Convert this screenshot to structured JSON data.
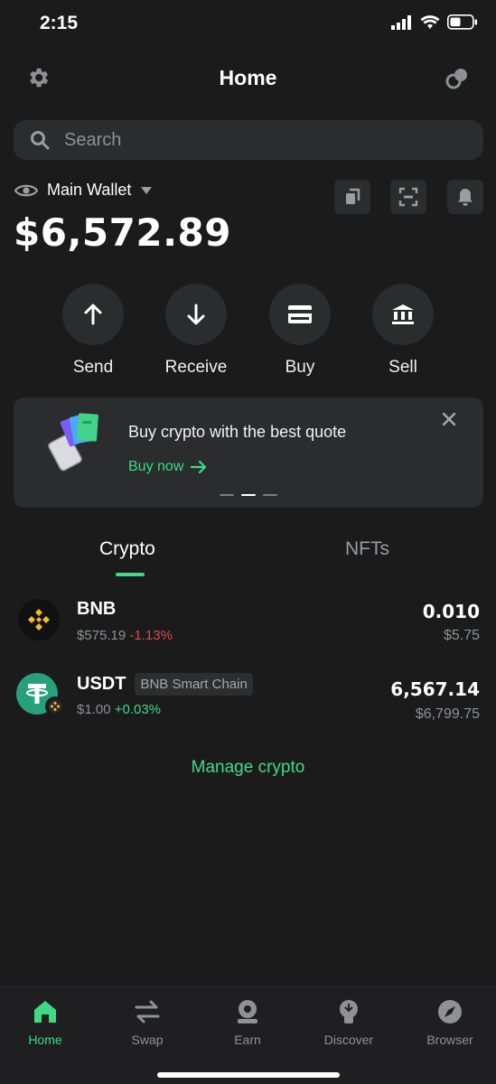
{
  "status": {
    "time": "2:15"
  },
  "header": {
    "title": "Home"
  },
  "search": {
    "placeholder": "Search"
  },
  "wallet": {
    "name": "Main Wallet",
    "balance": "$6,572.89"
  },
  "actions": [
    {
      "label": "Send",
      "icon": "arrow-up-icon"
    },
    {
      "label": "Receive",
      "icon": "arrow-down-icon"
    },
    {
      "label": "Buy",
      "icon": "card-icon"
    },
    {
      "label": "Sell",
      "icon": "bank-icon"
    }
  ],
  "banner": {
    "title": "Buy crypto with the best quote",
    "cta": "Buy now"
  },
  "tabs": [
    {
      "label": "Crypto",
      "active": true
    },
    {
      "label": "NFTs",
      "active": false
    }
  ],
  "assets": [
    {
      "symbol": "BNB",
      "price": "$575.19",
      "change": "-1.13%",
      "amount": "0.010",
      "value": "$5.75",
      "chain": ""
    },
    {
      "symbol": "USDT",
      "price": "$1.00",
      "change": "+0.03%",
      "amount": "6,567.14",
      "value": "$6,799.75",
      "chain": "BNB Smart Chain"
    }
  ],
  "manage": {
    "label": "Manage crypto"
  },
  "nav": [
    {
      "label": "Home",
      "active": true
    },
    {
      "label": "Swap",
      "active": false
    },
    {
      "label": "Earn",
      "active": false
    },
    {
      "label": "Discover",
      "active": false
    },
    {
      "label": "Browser",
      "active": false
    }
  ],
  "colors": {
    "accent": "#3ddc84",
    "negative": "#e0494f",
    "bnb": "#f3ba2f",
    "usdt": "#26a17b"
  }
}
